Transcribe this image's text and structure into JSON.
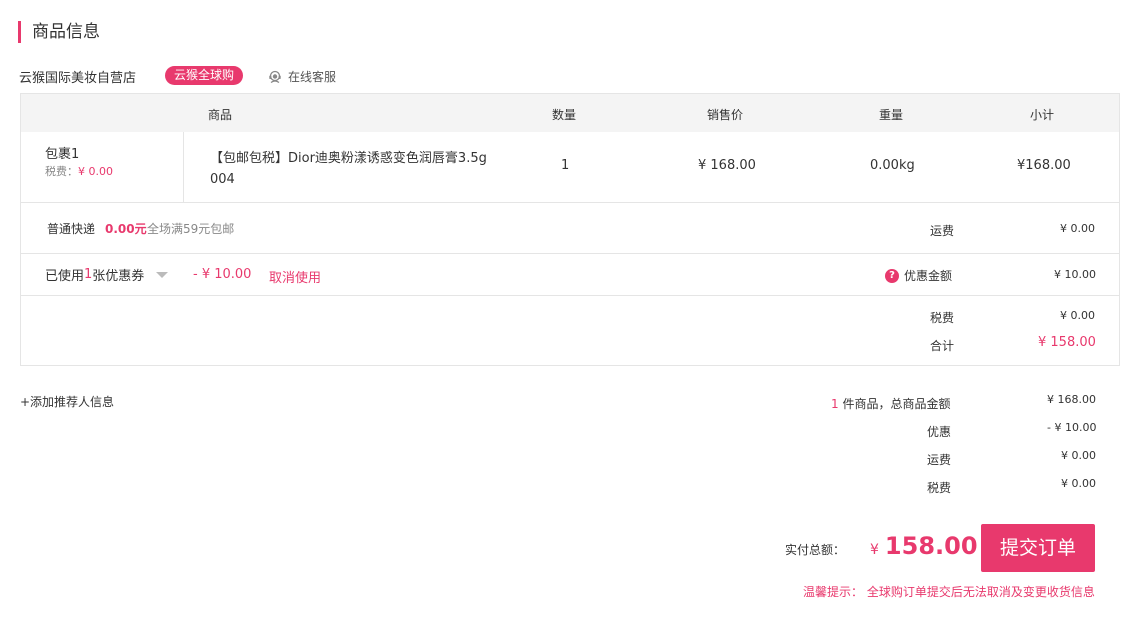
{
  "section_title": "商品信息",
  "store": {
    "name": "云猴国际美妆自营店",
    "badge": "云猴全球购",
    "customer_service": "在线客服"
  },
  "table": {
    "headers": [
      "商品",
      "数量",
      "销售价",
      "重量",
      "小计"
    ],
    "package": {
      "label": "包裹1",
      "tax_label": "税费：",
      "tax_value": "¥ 0.00"
    },
    "item": {
      "name": "【包邮包税】Dior迪奥粉漾诱惑变色润唇膏3.5g 004",
      "quantity": "1",
      "price": "¥ 168.00",
      "weight": "0.00kg",
      "subtotal": "¥168.00"
    }
  },
  "shipping": {
    "method": "普通快递",
    "price": "0.00元",
    "note": "全场满59元包邮",
    "label": "运费",
    "value": "¥ 0.00"
  },
  "coupon": {
    "prefix": "已使用",
    "count": "1",
    "suffix": "张优惠券",
    "amount": "- ¥ 10.00",
    "cancel": "取消使用",
    "discount_label": "优惠金额",
    "discount_value": "¥ 10.00"
  },
  "tax": {
    "label": "税费",
    "value": "¥ 0.00"
  },
  "total": {
    "label": "合计",
    "value": "¥ 158.00"
  },
  "referrer": {
    "label": "+添加推荐人信息"
  },
  "summary": {
    "count": "1",
    "goods_label": " 件商品，总商品金额",
    "goods_value": "¥ 168.00",
    "discount_label": "优惠",
    "discount_value": "- ¥ 10.00",
    "shipping_label": "运费",
    "shipping_value": "¥ 0.00",
    "tax_label": "税费",
    "tax_value": "¥ 0.00"
  },
  "pay": {
    "label": "实付总额：",
    "currency": "¥",
    "amount": "158.00",
    "submit": "提交订单"
  },
  "tip": {
    "label": "温馨提示：",
    "text": "全球购订单提交后无法取消及变更收货信息"
  },
  "colors": {
    "accent": "#e8396d",
    "header_bg": "#f4f4f4",
    "border": "#e5e5e5"
  }
}
